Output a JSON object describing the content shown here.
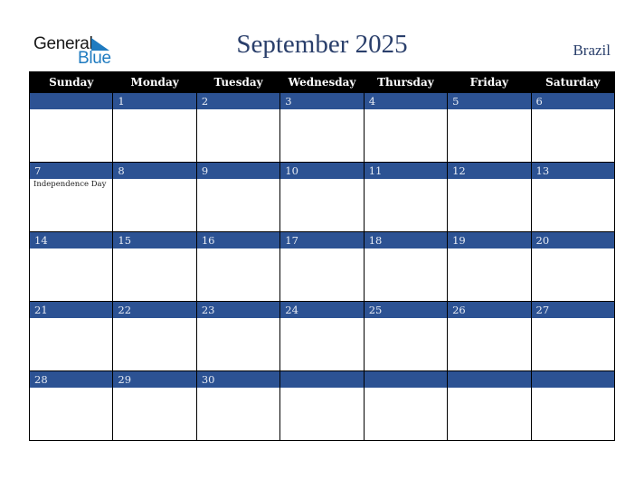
{
  "logo": {
    "line1": "General",
    "line2": "Blue",
    "icon": "triangle-flag-icon",
    "color": "#1f7bc0"
  },
  "header": {
    "title": "September 2025",
    "country": "Brazil"
  },
  "colors": {
    "header_bg": "#000000",
    "day_bar": "#2c5293",
    "title": "#2a3f6b"
  },
  "weekdays": [
    "Sunday",
    "Monday",
    "Tuesday",
    "Wednesday",
    "Thursday",
    "Friday",
    "Saturday"
  ],
  "weeks": [
    [
      {
        "day": ""
      },
      {
        "day": "1"
      },
      {
        "day": "2"
      },
      {
        "day": "3"
      },
      {
        "day": "4"
      },
      {
        "day": "5"
      },
      {
        "day": "6"
      }
    ],
    [
      {
        "day": "7",
        "holiday": "Independence Day"
      },
      {
        "day": "8"
      },
      {
        "day": "9"
      },
      {
        "day": "10"
      },
      {
        "day": "11"
      },
      {
        "day": "12"
      },
      {
        "day": "13"
      }
    ],
    [
      {
        "day": "14"
      },
      {
        "day": "15"
      },
      {
        "day": "16"
      },
      {
        "day": "17"
      },
      {
        "day": "18"
      },
      {
        "day": "19"
      },
      {
        "day": "20"
      }
    ],
    [
      {
        "day": "21"
      },
      {
        "day": "22"
      },
      {
        "day": "23"
      },
      {
        "day": "24"
      },
      {
        "day": "25"
      },
      {
        "day": "26"
      },
      {
        "day": "27"
      }
    ],
    [
      {
        "day": "28"
      },
      {
        "day": "29"
      },
      {
        "day": "30"
      },
      {
        "day": ""
      },
      {
        "day": ""
      },
      {
        "day": ""
      },
      {
        "day": ""
      }
    ]
  ]
}
